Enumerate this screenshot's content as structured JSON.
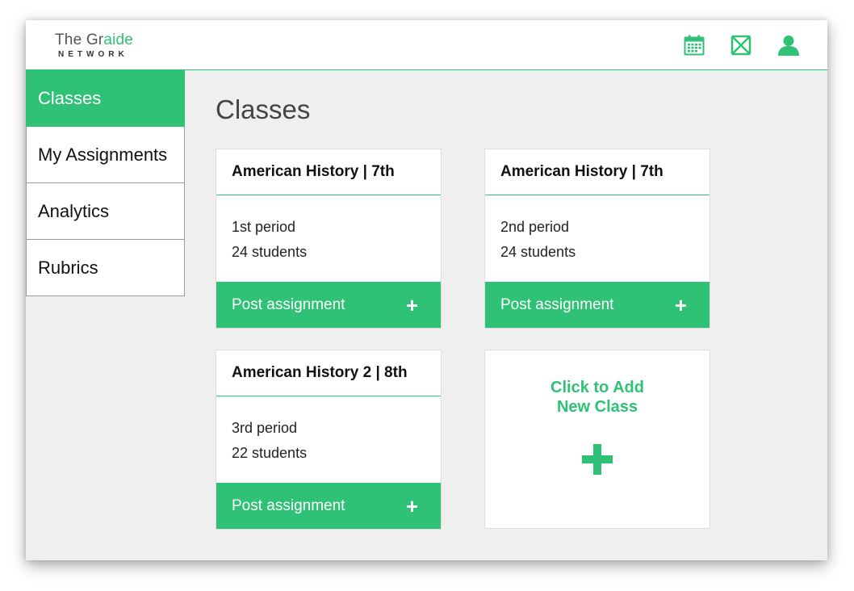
{
  "brand": {
    "name_plain": "The Gr",
    "name_accent": "aide",
    "sub": "NETWORK"
  },
  "header_icons": [
    "calendar-icon",
    "mail-icon",
    "user-icon"
  ],
  "colors": {
    "accent": "#2fc176",
    "background": "#efefef"
  },
  "sidebar": {
    "items": [
      {
        "label": "Classes",
        "active": true
      },
      {
        "label": "My Assignments",
        "active": false
      },
      {
        "label": "Analytics",
        "active": false
      },
      {
        "label": "Rubrics",
        "active": false
      }
    ]
  },
  "main": {
    "title": "Classes",
    "cards": [
      {
        "title": "American History | 7th",
        "period": "1st period",
        "students": "24 students",
        "button": "Post assignment",
        "button_icon": "+"
      },
      {
        "title": "American History | 7th",
        "period": "2nd period",
        "students": "24 students",
        "button": "Post assignment",
        "button_icon": "+"
      },
      {
        "title": "American History 2 | 8th",
        "period": "3rd period",
        "students": "22 students",
        "button": "Post assignment",
        "button_icon": "+"
      }
    ],
    "add_card": {
      "line1": "Click to Add",
      "line2": "New Class"
    }
  }
}
